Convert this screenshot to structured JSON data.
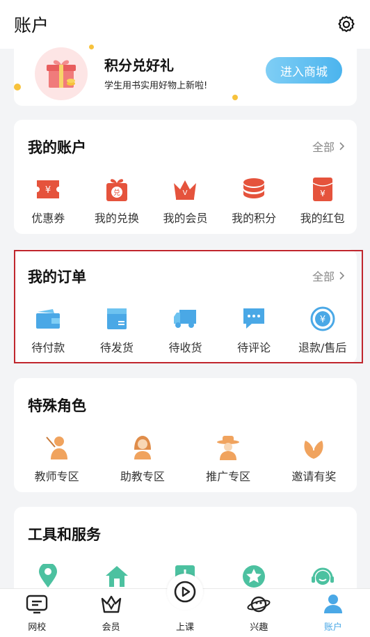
{
  "header": {
    "title": "账户",
    "settings_icon": "gear-icon"
  },
  "promo": {
    "title": "积分兑好礼",
    "subtitle": "学生用书实用好物上新啦!",
    "button": "进入商城",
    "icon": "gift-box-icon"
  },
  "account": {
    "title": "我的账户",
    "more": "全部",
    "items": [
      {
        "label": "优惠券",
        "icon": "coupon-icon"
      },
      {
        "label": "我的兑换",
        "icon": "exchange-gift-icon"
      },
      {
        "label": "我的会员",
        "icon": "crown-icon"
      },
      {
        "label": "我的积分",
        "icon": "coin-stack-icon"
      },
      {
        "label": "我的红包",
        "icon": "red-envelope-icon"
      }
    ]
  },
  "orders": {
    "title": "我的订单",
    "more": "全部",
    "items": [
      {
        "label": "待付款",
        "icon": "wallet-icon"
      },
      {
        "label": "待发货",
        "icon": "box-icon"
      },
      {
        "label": "待收货",
        "icon": "truck-icon"
      },
      {
        "label": "待评论",
        "icon": "comment-icon"
      },
      {
        "label": "退款/售后",
        "icon": "refund-icon"
      }
    ]
  },
  "roles": {
    "title": "特殊角色",
    "items": [
      {
        "label": "教师专区",
        "icon": "teacher-icon"
      },
      {
        "label": "助教专区",
        "icon": "assistant-icon"
      },
      {
        "label": "推广专区",
        "icon": "promoter-icon"
      },
      {
        "label": "邀请有奖",
        "icon": "invite-icon"
      }
    ]
  },
  "tools": {
    "title": "工具和服务",
    "items": [
      {
        "icon": "location-pin-icon"
      },
      {
        "icon": "home-icon"
      },
      {
        "icon": "download-icon"
      },
      {
        "icon": "star-icon"
      },
      {
        "icon": "customer-service-icon"
      }
    ]
  },
  "tabbar": {
    "active": "账户",
    "tabs": [
      {
        "label": "网校",
        "icon": "school-tv-icon"
      },
      {
        "label": "会员",
        "icon": "member-crown-icon"
      },
      {
        "label": "上课",
        "icon": "play-bubble-icon"
      },
      {
        "label": "兴趣",
        "icon": "planet-icon"
      },
      {
        "label": "账户",
        "icon": "user-icon"
      }
    ]
  },
  "colors": {
    "accent_blue": "#4aa8e6",
    "account_red": "#e5533c",
    "role_orange": "#f0a35e",
    "tool_green": "#4cc1a0",
    "highlight_red": "#c0262d"
  }
}
